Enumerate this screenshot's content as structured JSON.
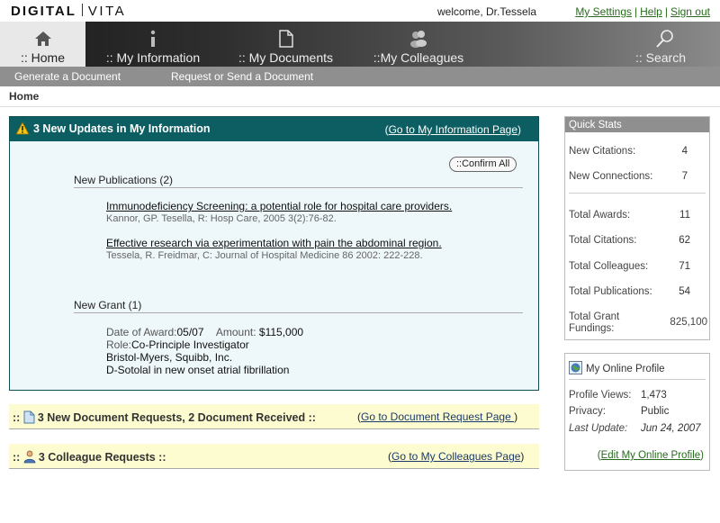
{
  "brand": {
    "left": "DIGITAL",
    "right": "VITA"
  },
  "header": {
    "welcome": "welcome, Dr.Tessela",
    "links": {
      "settings": "My Settings",
      "help": "Help",
      "signout": "Sign out"
    }
  },
  "nav": {
    "tabs": [
      {
        "label": ":: Home",
        "icon": "home-icon"
      },
      {
        "label": ":: My Information",
        "icon": "info-icon"
      },
      {
        "label": ":: My Documents",
        "icon": "document-icon"
      },
      {
        "label": "::My Colleagues",
        "icon": "colleagues-icon"
      },
      {
        "label": ":: Search",
        "icon": "search-icon"
      }
    ],
    "active": "Home"
  },
  "subnav": {
    "generate": "Generate a Document",
    "request": "Request or Send a Document"
  },
  "breadcrumb": "Home",
  "updates": {
    "title": "3 New Updates in My Information",
    "link_open": "(",
    "link_text": "Go to My Information Page",
    "link_close": ")",
    "confirm_all": "::Confirm All",
    "publications_title": "New Publications (2)",
    "publications": [
      {
        "title": "Immunodeficiency Screening: a potential role for hospital care providers.",
        "meta": "Kannor, GP. Tesella, R: Hosp Care, 2005 3(2):76-82."
      },
      {
        "title": "Effective research via experimentation with pain the abdominal region.",
        "meta": "Tessela, R. Freidmar, C: Journal of Hospital Medicine 86 2002: 222-228."
      }
    ],
    "grant_title": "New Grant (1)",
    "grant": {
      "date_label": "Date of Award:",
      "date_value": "05/07",
      "amount_label": "Amount:",
      "amount_value": "$115,000",
      "role_label": "Role:",
      "role_value": "Co-Principle Investigator",
      "sponsor": "Bristol-Myers, Squibb, Inc.",
      "project": "D-Sotolal in new onset atrial fibrillation"
    }
  },
  "doc_requests": {
    "prefix": "::",
    "text": "3 New Document Requests, 2 Document Received ::",
    "link_text": "Go to Document Request Page ",
    "icon": "document-icon"
  },
  "colleague_requests": {
    "prefix": "::",
    "text": "3 Colleague Requests ::",
    "link_text": "Go to My Colleagues Page",
    "icon": "colleague-icon"
  },
  "quick_stats": {
    "title": "Quick Stats",
    "rows": [
      {
        "label": "New Citations:",
        "value": "4"
      },
      {
        "label": "New Connections:",
        "value": "7"
      },
      {
        "label": "Total Awards:",
        "value": "11"
      },
      {
        "label": "Total Citations:",
        "value": "62"
      },
      {
        "label": "Total Colleagues:",
        "value": "71"
      },
      {
        "label": "Total Publications:",
        "value": "54"
      },
      {
        "label": "Total Grant Fundings:",
        "value": "825,100"
      }
    ]
  },
  "online_profile": {
    "title": "My Online Profile",
    "views_label": "Profile Views:",
    "views_value": "1,473",
    "privacy_label": "Privacy:",
    "privacy_value": "Public",
    "update_label": "Last Update:",
    "update_value": "Jun 24, 2007",
    "edit_link": "Edit My Online Profile"
  },
  "colors": {
    "accent": "#0d5e62",
    "banner": "#fdfcd0",
    "link_green": "#2a6a1f"
  }
}
